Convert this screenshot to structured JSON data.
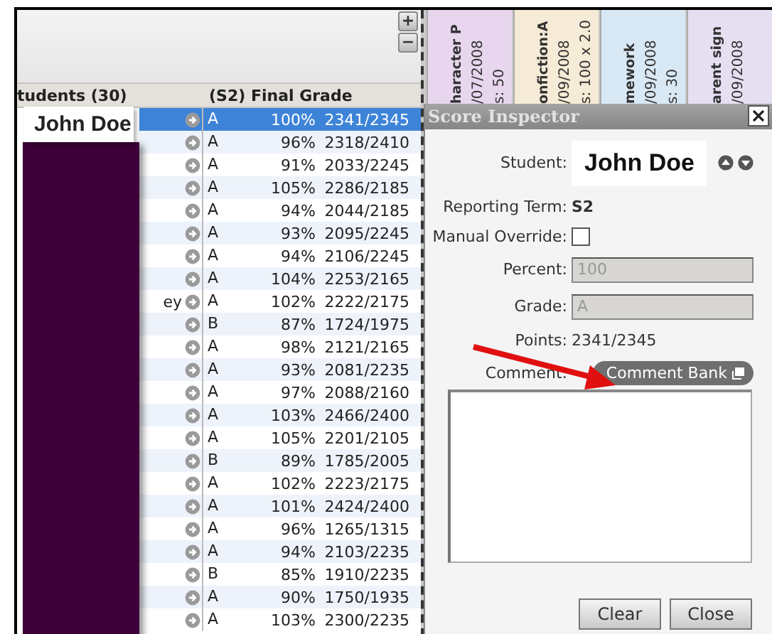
{
  "grid": {
    "zoom_buttons": [
      "+",
      "−"
    ],
    "columns": [
      "tudents (30)",
      "(S2) Final Grade"
    ],
    "name_label": "John Doe",
    "rows": [
      {
        "grade": "A",
        "percent": "100%",
        "points": "2341/2345",
        "selected": true
      },
      {
        "grade": "A",
        "percent": "96%",
        "points": "2318/2410",
        "selected": false
      },
      {
        "grade": "A",
        "percent": "91%",
        "points": "2033/2245",
        "selected": false
      },
      {
        "grade": "A",
        "percent": "105%",
        "points": "2286/2185",
        "selected": false
      },
      {
        "grade": "A",
        "percent": "94%",
        "points": "2044/2185",
        "selected": false
      },
      {
        "grade": "A",
        "percent": "93%",
        "points": "2095/2245",
        "selected": false
      },
      {
        "grade": "A",
        "percent": "94%",
        "points": "2106/2245",
        "selected": false
      },
      {
        "grade": "A",
        "percent": "104%",
        "points": "2253/2165",
        "selected": false
      },
      {
        "name": "ey",
        "grade": "A",
        "percent": "102%",
        "points": "2222/2175",
        "selected": false
      },
      {
        "grade": "B",
        "percent": "87%",
        "points": "1724/1975",
        "selected": false
      },
      {
        "grade": "A",
        "percent": "98%",
        "points": "2121/2165",
        "selected": false
      },
      {
        "grade": "A",
        "percent": "93%",
        "points": "2081/2235",
        "selected": false
      },
      {
        "grade": "A",
        "percent": "97%",
        "points": "2088/2160",
        "selected": false
      },
      {
        "grade": "A",
        "percent": "103%",
        "points": "2466/2400",
        "selected": false
      },
      {
        "grade": "A",
        "percent": "105%",
        "points": "2201/2105",
        "selected": false
      },
      {
        "grade": "B",
        "percent": "89%",
        "points": "1785/2005",
        "selected": false
      },
      {
        "grade": "A",
        "percent": "102%",
        "points": "2223/2175",
        "selected": false
      },
      {
        "grade": "A",
        "percent": "101%",
        "points": "2424/2400",
        "selected": false
      },
      {
        "grade": "A",
        "percent": "96%",
        "points": "1265/1315",
        "selected": false
      },
      {
        "grade": "A",
        "percent": "94%",
        "points": "2103/2235",
        "selected": false
      },
      {
        "grade": "B",
        "percent": "85%",
        "points": "1910/2235",
        "selected": false
      },
      {
        "grade": "A",
        "percent": "90%",
        "points": "1750/1935",
        "selected": false
      },
      {
        "grade": "A",
        "percent": "103%",
        "points": "2300/2235",
        "selected": false
      }
    ]
  },
  "assignment_headers": [
    {
      "lines": [
        "haracter P",
        "/07/2008",
        "s: 50"
      ],
      "color": "#e8d6ef"
    },
    {
      "lines": [
        "onfiction:A",
        "/09/2008",
        "s: 100 x 2.0"
      ],
      "color": "#f6ebd6"
    },
    {
      "lines": [
        "mework",
        "/09/2008",
        "s: 30"
      ],
      "color": "#d9e8f5"
    },
    {
      "lines": [
        "arent sign",
        "/09/2008"
      ],
      "color": "#e6dff2"
    }
  ],
  "inspector": {
    "title": "Score Inspector",
    "student_label": "Student:",
    "student": "John Doe",
    "term_label": "Reporting Term:",
    "term": "S2",
    "override_label": "Manual Override:",
    "override_checked": false,
    "percent_label": "Percent:",
    "percent": {
      "value": "100",
      "disabled": true
    },
    "grade_label": "Grade:",
    "grade": {
      "value": "A",
      "disabled": true
    },
    "points_label": "Points:",
    "points": "2341/2345",
    "comment_label": "Comment:",
    "comment_bank": "Comment Bank",
    "buttons": [
      "Clear",
      "Close"
    ]
  }
}
